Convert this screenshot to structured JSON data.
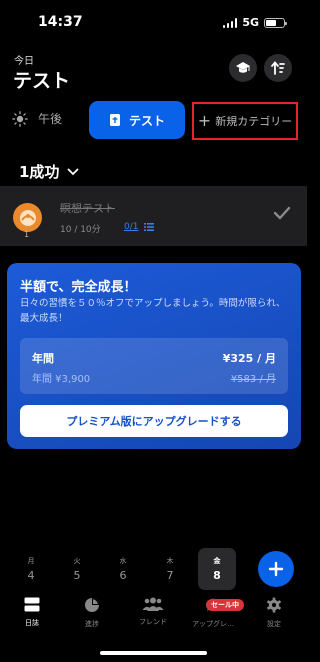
{
  "status": {
    "time": "14:37",
    "network": "5G"
  },
  "header": {
    "date_label": "今日",
    "title": "テスト"
  },
  "tabs": {
    "time_label": "午後",
    "test_label": "テスト",
    "new_category_label": "新規カテゴリー"
  },
  "success": {
    "label": "1成功"
  },
  "habit": {
    "name": "瞑想テスト",
    "count": "1",
    "meta": "10 / 10分",
    "progress": "0/1"
  },
  "promo": {
    "title": "半額で、完全成長！",
    "description": "日々の習慣を５０％オフでアップしましょう。時間が限られ、最大成長！",
    "plan_name": "年間",
    "plan_price": "¥325 / 月",
    "plan_old_price": "年間 ¥3,900",
    "plan_struck_price": "¥583 / 月",
    "upgrade_label": "プレミアム版にアップグレードする"
  },
  "week": [
    {
      "label": "月",
      "num": "4"
    },
    {
      "label": "火",
      "num": "5"
    },
    {
      "label": "水",
      "num": "6"
    },
    {
      "label": "木",
      "num": "7"
    },
    {
      "label": "金",
      "num": "8",
      "active": true
    }
  ],
  "tabbar": [
    {
      "label": "日誌",
      "icon": "journal-icon",
      "active": true
    },
    {
      "label": "進捗",
      "icon": "pie-chart-icon"
    },
    {
      "label": "フレンド",
      "icon": "friends-icon"
    },
    {
      "label": "アップグレ…",
      "icon": "upgrade-icon"
    },
    {
      "label": "設定",
      "icon": "gear-icon"
    }
  ],
  "sale_badge": "セール中",
  "colors": {
    "accent": "#0a62e8",
    "highlight_border": "#e5242b",
    "habit_avatar": "#ea8a2e",
    "promo_gradient": "#1d5bd8",
    "sale_badge": "#d8343a"
  }
}
